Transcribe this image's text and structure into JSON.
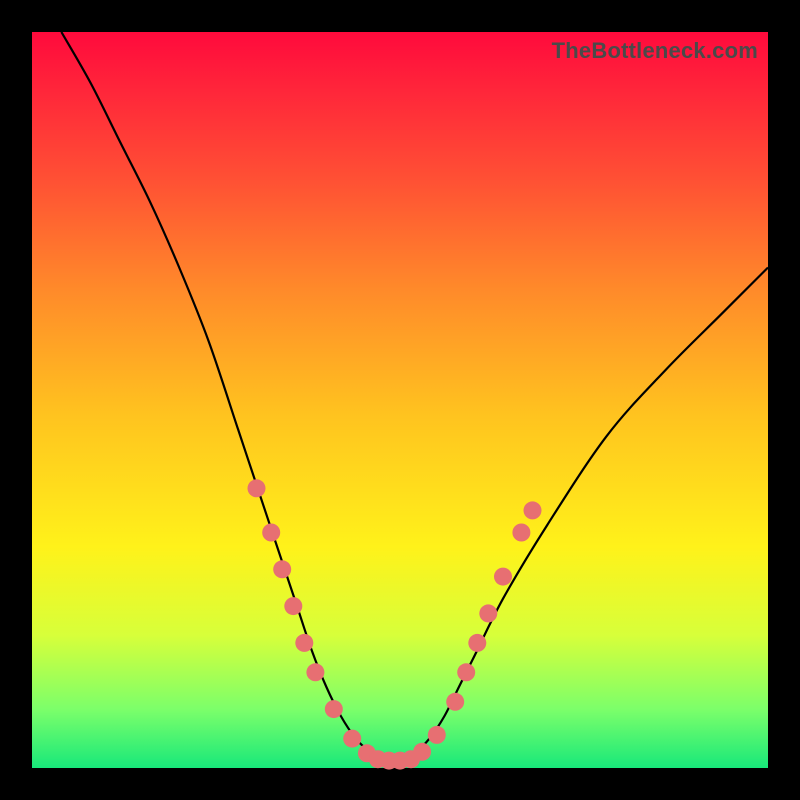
{
  "watermark": "TheBottleneck.com",
  "chart_data": {
    "type": "line",
    "title": "",
    "xlabel": "",
    "ylabel": "",
    "xlim": [
      0,
      100
    ],
    "ylim": [
      0,
      100
    ],
    "curve": {
      "name": "bottleneck-curve",
      "x": [
        4,
        8,
        12,
        16,
        20,
        24,
        28,
        30,
        32,
        34,
        36,
        38,
        40,
        42,
        44,
        46,
        47,
        48,
        50,
        52,
        54,
        56,
        58,
        60,
        64,
        70,
        78,
        86,
        94,
        100
      ],
      "y": [
        100,
        93,
        85,
        77,
        68,
        58,
        46,
        40,
        34,
        28,
        22,
        16,
        11,
        7,
        4,
        2,
        1,
        1,
        1,
        2,
        4,
        7,
        11,
        15,
        23,
        33,
        45,
        54,
        62,
        68
      ]
    },
    "markers": {
      "name": "near-minimum-markers",
      "points": [
        {
          "x": 30.5,
          "y": 38
        },
        {
          "x": 32.5,
          "y": 32
        },
        {
          "x": 34.0,
          "y": 27
        },
        {
          "x": 35.5,
          "y": 22
        },
        {
          "x": 37.0,
          "y": 17
        },
        {
          "x": 38.5,
          "y": 13
        },
        {
          "x": 41.0,
          "y": 8
        },
        {
          "x": 43.5,
          "y": 4
        },
        {
          "x": 45.5,
          "y": 2
        },
        {
          "x": 47.0,
          "y": 1.2
        },
        {
          "x": 48.5,
          "y": 1
        },
        {
          "x": 50.0,
          "y": 1
        },
        {
          "x": 51.5,
          "y": 1.2
        },
        {
          "x": 53.0,
          "y": 2.2
        },
        {
          "x": 55.0,
          "y": 4.5
        },
        {
          "x": 57.5,
          "y": 9
        },
        {
          "x": 59.0,
          "y": 13
        },
        {
          "x": 60.5,
          "y": 17
        },
        {
          "x": 62.0,
          "y": 21
        },
        {
          "x": 64.0,
          "y": 26
        },
        {
          "x": 66.5,
          "y": 32
        },
        {
          "x": 68.0,
          "y": 35
        }
      ]
    }
  }
}
